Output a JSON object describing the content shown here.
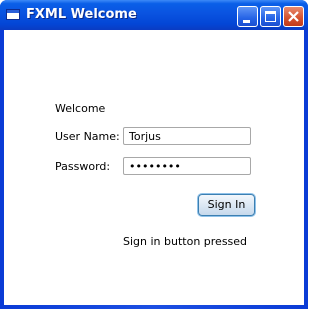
{
  "window": {
    "title": "FXML Welcome",
    "buttons": {
      "minimize": "minimize-icon",
      "maximize": "maximize-icon",
      "close": "close-icon"
    }
  },
  "form": {
    "welcome": "Welcome",
    "username_label": "User Name:",
    "username_value": "Torjus",
    "password_label": "Password:",
    "password_value": "••••••••",
    "signin_label": "Sign In",
    "status_text": "Sign in button pressed"
  },
  "colors": {
    "titlebar": "#0a53e0",
    "close_button": "#d4512e",
    "focus_ring": "#8fc2ea"
  }
}
